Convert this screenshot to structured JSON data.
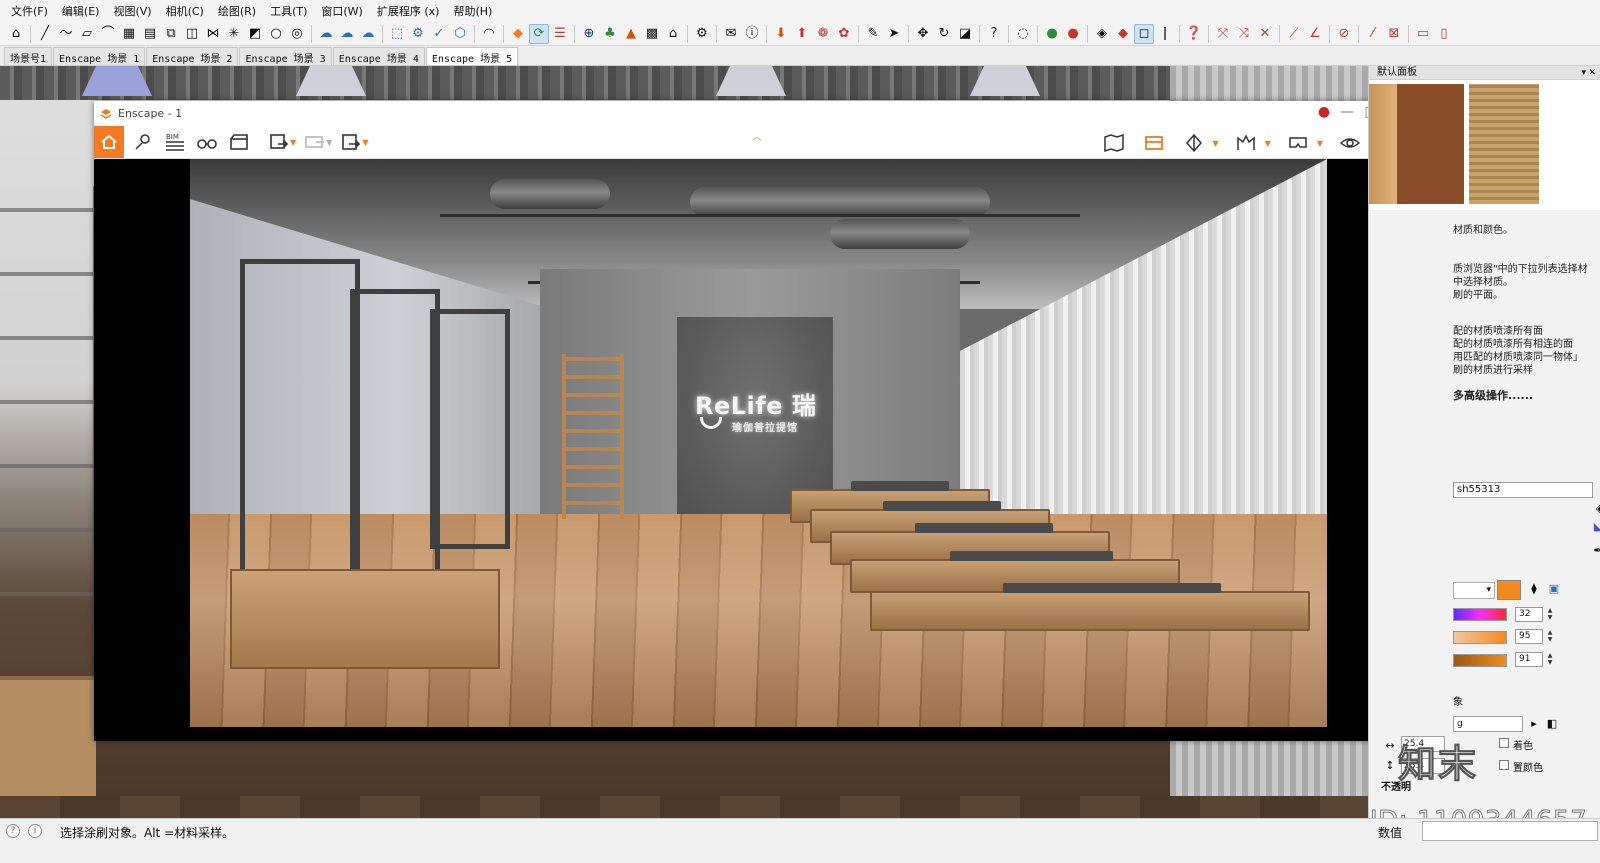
{
  "menus": [
    "文件(F)",
    "编辑(E)",
    "视图(V)",
    "相机(C)",
    "绘图(R)",
    "工具(T)",
    "窗口(W)",
    "扩展程序 (x)",
    "帮助(H)"
  ],
  "scene_tabs": [
    "场景号1",
    "Enscape 场景 1",
    "Enscape 场景 2",
    "Enscape 场景 3",
    "Enscape 场景 4",
    "Enscape 场景 5"
  ],
  "scene_tab_active": 5,
  "enscape": {
    "title": "Enscape - 1",
    "bim_label": "BIM",
    "render_sign": {
      "main": "ReLife 瑞",
      "sub": "瑜伽普拉提馆"
    }
  },
  "panel": {
    "title": "默认面板",
    "help_lines": [
      "材质和颜色。",
      "质浏览器\"中的下拉列表选择材",
      "中选择材质。",
      "刷的平面。",
      "配的材质喷漆所有面",
      "配的材质喷漆所有相连的面",
      "用匹配的材质喷漆同一物体」",
      "刷的材质进行采样"
    ],
    "help_more": "多高级操作......",
    "material_name": "sh55313",
    "color_hex": "#F28A1F",
    "hsl_values": {
      "h": "32",
      "s": "95",
      "l": "91"
    },
    "texture_label": "g",
    "size_width": "25.4",
    "size_height": "25.4",
    "colorize_label": "着色",
    "reset_color_label": "置颜色",
    "opacity_label": "不透明",
    "accent": "#F47920"
  },
  "status": {
    "message": "选择涂刷对象。Alt =材料采样。",
    "measure_label": "数值",
    "measure_value": ""
  },
  "watermark": {
    "logo": "知末",
    "id": "ID: 1109344657"
  }
}
